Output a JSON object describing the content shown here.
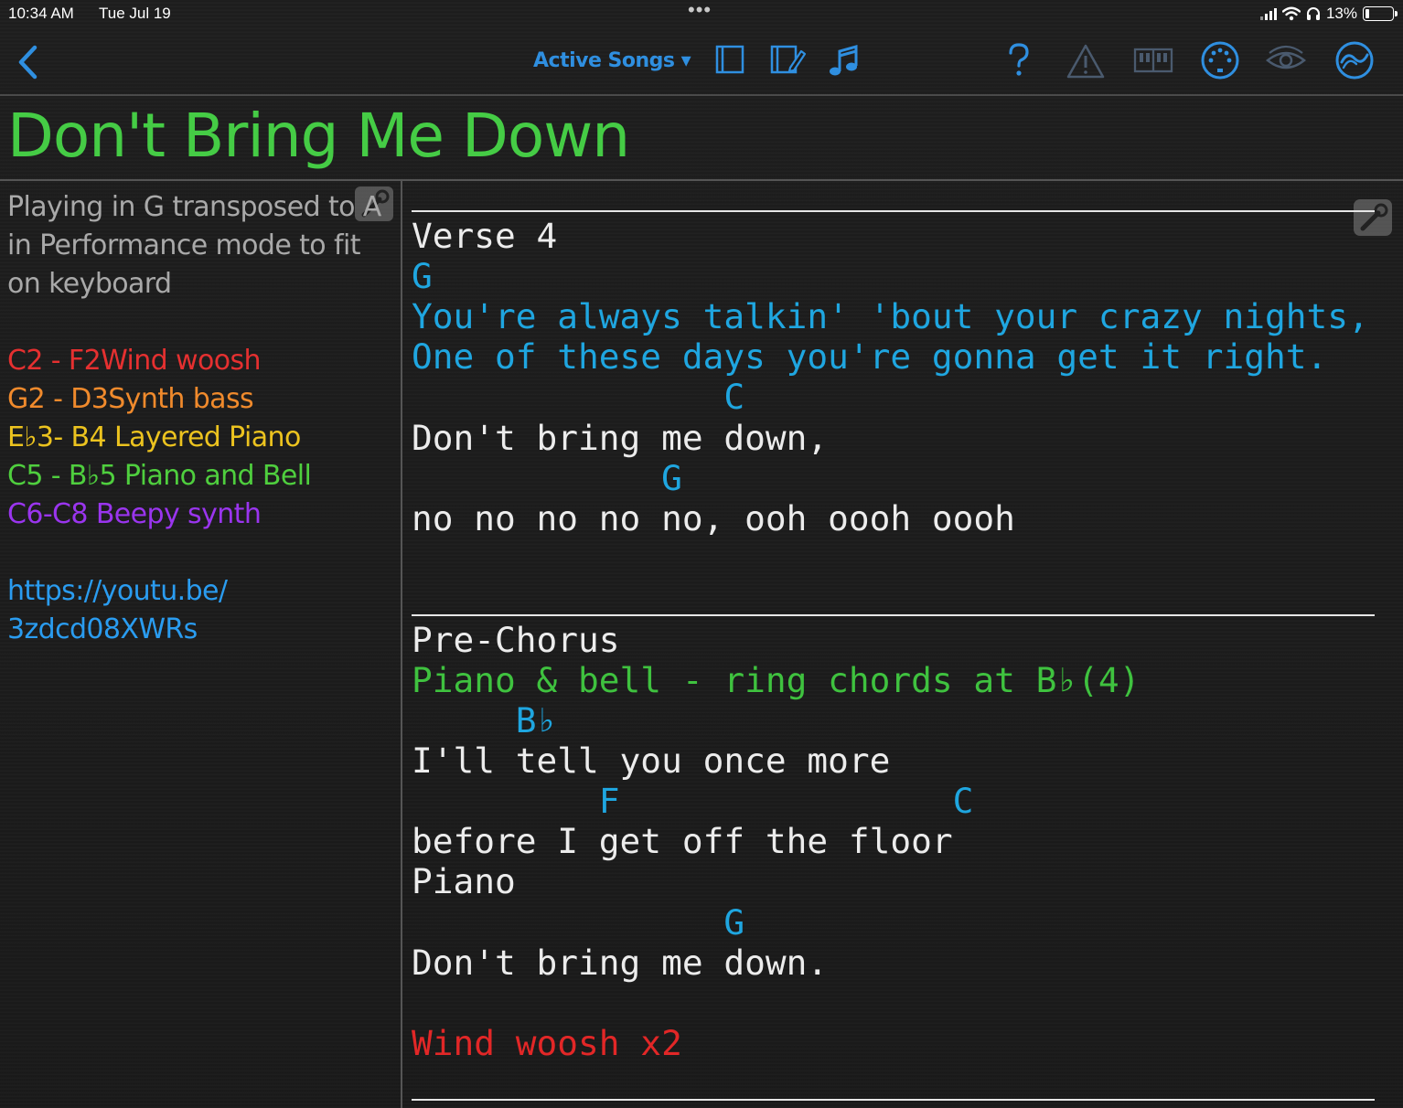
{
  "status_bar": {
    "time": "10:34 AM",
    "date": "Tue Jul 19",
    "dots": "•••",
    "battery": "13%"
  },
  "toolbar": {
    "set_list_label": "Active Songs ▾",
    "icons": [
      "back-chevron-icon",
      "layout-icon",
      "edit-page-icon",
      "music-note-icon",
      "help-icon",
      "warning-icon",
      "piano-keys-icon",
      "midi-icon",
      "eye-icon",
      "sync-icon"
    ]
  },
  "song": {
    "title": "Don't Bring Me Down"
  },
  "notes": {
    "intro": [
      "Playing in G transposed to A",
      "in Performance mode to fit",
      "on keyboard"
    ],
    "zones": [
      {
        "text": "C2 - F2Wind woosh",
        "color": "#e53030"
      },
      {
        "text": "G2 - D3Synth bass",
        "color": "#f08a2c"
      },
      {
        "text": "E♭3- B4 Layered Piano",
        "color": "#ecc31f"
      },
      {
        "text": "C5 - B♭5 Piano and Bell",
        "color": "#4fcf3e"
      },
      {
        "text": "C6-C8 Beepy synth",
        "color": "#9a35ee"
      }
    ],
    "link": [
      "https://youtu.be/",
      "3zdcd08XWRs"
    ],
    "link_color": "#2a9cf0"
  },
  "chart": {
    "lines": [
      {
        "text": "Verse 4",
        "color": "white"
      },
      {
        "text": "G",
        "color": "blue"
      },
      {
        "text": "You're always talkin' 'bout your crazy nights,",
        "color": "blue"
      },
      {
        "text": "One of these days you're gonna get it right.",
        "color": "blue"
      },
      {
        "text": "               C",
        "color": "blue"
      },
      {
        "text": "Don't bring me down,",
        "color": "white"
      },
      {
        "text": "            G",
        "color": "blue"
      },
      {
        "text": "no no no no no, ooh oooh oooh",
        "color": "white"
      },
      {
        "text": "Pre-Chorus",
        "color": "white"
      },
      {
        "text": "Piano & bell - ring chords at B♭(4)",
        "color": "green"
      },
      {
        "text": "     B♭",
        "color": "blue"
      },
      {
        "text": "I'll tell you once more",
        "color": "white"
      },
      {
        "text": "         F                C",
        "color": "blue"
      },
      {
        "text": "before I get off the floor",
        "color": "white"
      },
      {
        "text": "Piano",
        "color": "white"
      },
      {
        "text": "               G",
        "color": "blue"
      },
      {
        "text": "Don't bring me down.",
        "color": "white"
      },
      {
        "text": "Wind woosh x2",
        "color": "red"
      }
    ]
  }
}
